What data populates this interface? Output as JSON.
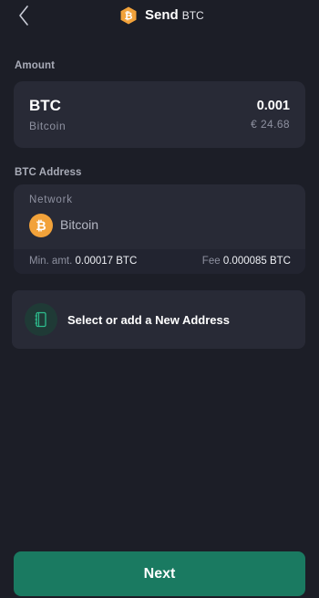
{
  "header": {
    "title": "Send",
    "title_sub": "BTC",
    "back_icon": "chevron-left-icon",
    "logo_icon": "bitcoin-hex-icon"
  },
  "amount": {
    "label": "Amount",
    "symbol": "BTC",
    "name": "Bitcoin",
    "value": "0.001",
    "fiat": "€ 24.68"
  },
  "address": {
    "label": "BTC Address",
    "network_label": "Network",
    "network_name": "Bitcoin",
    "coin_glyph": "₿",
    "min_label": "Min. amt.",
    "min_value": "0.00017 BTC",
    "fee_label": "Fee",
    "fee_value": "0.000085 BTC"
  },
  "select_address": {
    "label": "Select or add a New Address",
    "icon": "address-book-icon"
  },
  "next_label": "Next",
  "colors": {
    "background": "#1c1e27",
    "card": "#282a36",
    "accent": "#1a7a61",
    "bitcoin": "#f2a23a"
  }
}
